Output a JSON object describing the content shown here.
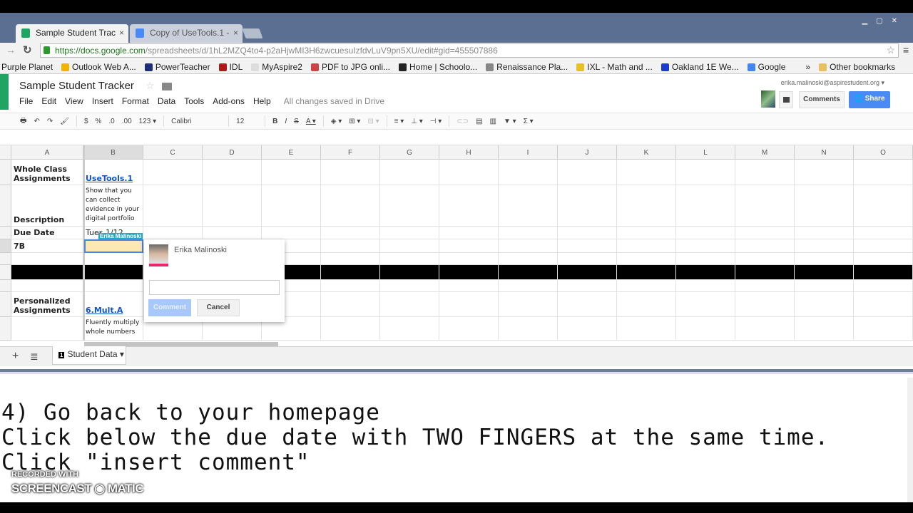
{
  "browser": {
    "tabs": [
      {
        "title": "Sample Student Trac",
        "icon": "sheets-icon",
        "color": "#1fa463"
      },
      {
        "title": "Copy of UseTools.1 -",
        "icon": "docs-icon",
        "color": "#4a8af4"
      }
    ],
    "url_prefix": "https://",
    "url_host": "docs.google.com",
    "url_path": "/spreadsheets/d/1hL2MZQ4to4-p2aHjwMI3H6zwcuesuIzfdvLuV9pn5XU/edit#gid=455507886",
    "bookmarks": [
      {
        "label": "Purple Planet",
        "color": ""
      },
      {
        "label": "Outlook Web A...",
        "color": "#f0b400"
      },
      {
        "label": "PowerTeacher",
        "color": "#1e2f7a"
      },
      {
        "label": "IDL",
        "color": "#b01818"
      },
      {
        "label": "MyAspire2",
        "color": "#ddd"
      },
      {
        "label": "PDF to JPG onli...",
        "color": "#c44"
      },
      {
        "label": "Home | Schoolo...",
        "color": "#222"
      },
      {
        "label": "Renaissance Pla...",
        "color": "#888"
      },
      {
        "label": "IXL - Math and ...",
        "color": "#e8c020"
      },
      {
        "label": "Oakland 1E We...",
        "color": "#1a3ad0"
      },
      {
        "label": "Google",
        "color": "#4285f4"
      }
    ],
    "more": "»",
    "other_bookmarks": "Other bookmarks"
  },
  "sheets": {
    "title": "Sample Student Tracker",
    "menu": [
      "File",
      "Edit",
      "View",
      "Insert",
      "Format",
      "Data",
      "Tools",
      "Add-ons",
      "Help"
    ],
    "saved_status": "All changes saved in Drive",
    "email": "erika.malinoski@aspirestudent.org ▾",
    "comments_label": "Comments",
    "share_label": "Share",
    "toolbar": {
      "currency": "$",
      "percent": "%",
      "dec_less": ".0",
      "dec_more": ".00",
      "format": "123 ▾",
      "font": "Calibri",
      "font_size": "12"
    },
    "columns": [
      "A",
      "B",
      "C",
      "D",
      "E",
      "F",
      "G",
      "H",
      "I",
      "J",
      "K",
      "L",
      "M",
      "N",
      "O"
    ],
    "rows": [
      {
        "a": "Whole Class Assignments",
        "b": "UseTools.1",
        "b_style": "link"
      },
      {
        "a": "Description",
        "b": "Show that you can collect evidence in your digital portfolio",
        "b_style": "small"
      },
      {
        "a": "Due Date",
        "b": "Tues 1/12",
        "b_style": ""
      },
      {
        "a": "7B",
        "b": "",
        "b_style": "selected"
      },
      {
        "a": "",
        "b": "",
        "b_style": ""
      },
      {
        "a": "",
        "b": "",
        "b_style": "black"
      },
      {
        "a": "",
        "b": "",
        "b_style": ""
      },
      {
        "a": "Personalized Assignments",
        "b": "6.Mult.A",
        "b_style": "link"
      },
      {
        "a": "",
        "b": "Fluently multiply whole numbers",
        "b_style": "small"
      }
    ],
    "collaborator_flag": "Erika Malinoski",
    "comment_popup": {
      "author": "Erika Malinoski",
      "input_value": "",
      "comment_label": "Comment",
      "cancel_label": "Cancel"
    },
    "sheet_tab": {
      "number": "1",
      "name": "Student Data ▾"
    }
  },
  "instructions": "4) Go back to your homepage\nClick below the due date with TWO FINGERS at the same time.\nClick \"insert comment\"",
  "watermark": {
    "line1": "RECORDED WITH",
    "line2": "SCREENCAST ◉ MATIC"
  }
}
